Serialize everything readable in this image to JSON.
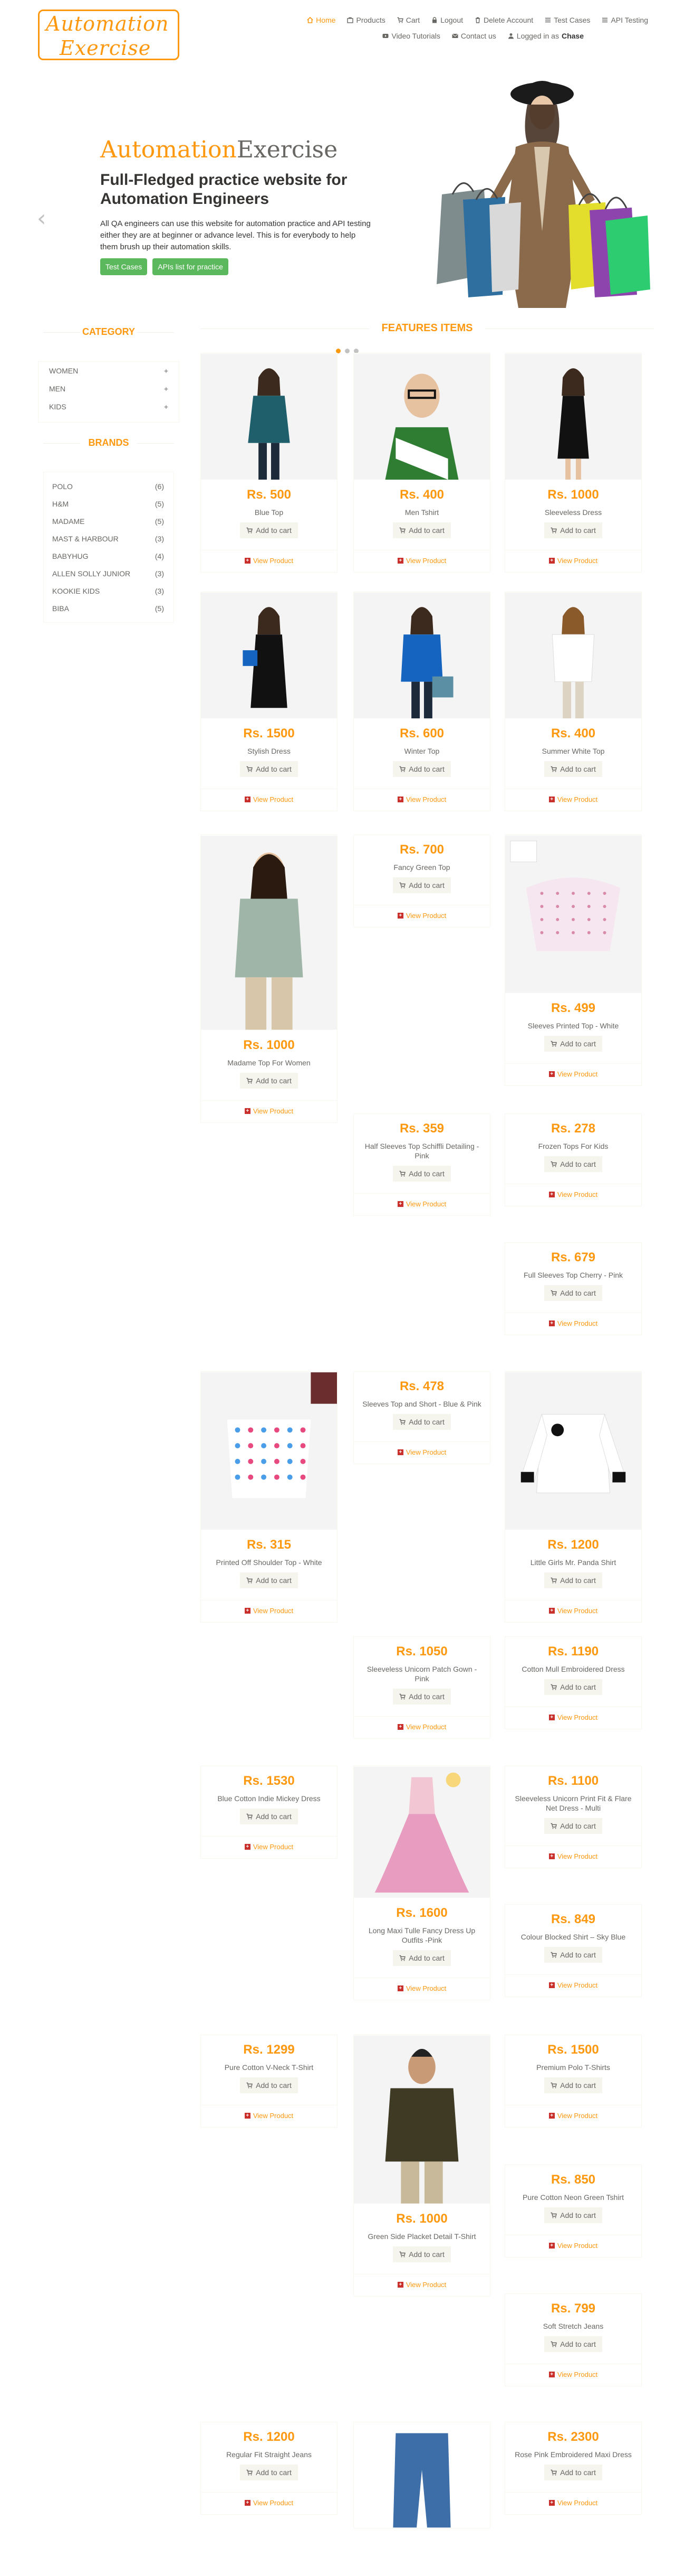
{
  "logo": {
    "line1": "Automation",
    "line2": "Exercise"
  },
  "nav": {
    "row1": [
      {
        "label": "Home",
        "icon": "home-icon",
        "active": true
      },
      {
        "label": "Products",
        "icon": "product-icon"
      },
      {
        "label": "Cart",
        "icon": "cart-icon"
      },
      {
        "label": "Logout",
        "icon": "lock-icon"
      },
      {
        "label": "Delete Account",
        "icon": "trash-icon"
      },
      {
        "label": "Test Cases",
        "icon": "list-icon"
      },
      {
        "label": "API Testing",
        "icon": "list-icon"
      }
    ],
    "row2": [
      {
        "label": "Video Tutorials",
        "icon": "youtube-icon"
      },
      {
        "label": "Contact us",
        "icon": "envelope-icon"
      },
      {
        "label": "Logged in as",
        "icon": "user-icon",
        "user": "Chase"
      }
    ]
  },
  "slider": {
    "brand_a": "Automation",
    "brand_b": "Exercise",
    "heading": "Full-Fledged practice website for Automation Engineers",
    "body": "All QA engineers can use this website for automation practice and API testing either they are at beginner or advance level. This is for everybody to help them brush up their automation skills.",
    "btn_test_cases": "Test Cases",
    "btn_apis": "APIs list for practice",
    "prev": "‹",
    "next": "›"
  },
  "sidebar": {
    "category_title": "CATEGORY",
    "categories": [
      "Women",
      "Men",
      "Kids"
    ],
    "brands_title": "BRANDS",
    "brands": [
      {
        "name": "Polo",
        "count": "(6)"
      },
      {
        "name": "H&M",
        "count": "(5)"
      },
      {
        "name": "Madame",
        "count": "(5)"
      },
      {
        "name": "Mast & Harbour",
        "count": "(3)"
      },
      {
        "name": "Babyhug",
        "count": "(4)"
      },
      {
        "name": "Allen Solly Junior",
        "count": "(3)"
      },
      {
        "name": "Kookie Kids",
        "count": "(3)"
      },
      {
        "name": "Biba",
        "count": "(5)"
      }
    ]
  },
  "features_title": "Features Items",
  "labels": {
    "add_to_cart": "Add to cart",
    "view_product": "View Product"
  },
  "products": [
    {
      "price": "Rs. 500",
      "name": "Blue Top",
      "img": "woman-blue-top"
    },
    {
      "price": "Rs. 400",
      "name": "Men Tshirt",
      "img": "man-tshirt"
    },
    {
      "price": "Rs. 1000",
      "name": "Sleeveless Dress",
      "img": "black-dress"
    },
    {
      "price": "Rs. 1500",
      "name": "Stylish Dress",
      "img": "stylish-dress"
    },
    {
      "price": "Rs. 600",
      "name": "Winter Top",
      "img": "winter-top"
    },
    {
      "price": "Rs. 400",
      "name": "Summer White Top",
      "img": "white-top"
    },
    {
      "price": "Rs. 1000",
      "name": "Madame Top For Women",
      "img": "madame-top"
    },
    {
      "price": "Rs. 700",
      "name": "Fancy Green Top",
      "img": ""
    },
    {
      "price": "Rs. 499",
      "name": "Sleeves Printed Top - White",
      "img": "kids-white-top"
    },
    {
      "price": "Rs. 359",
      "name": "Half Sleeves Top Schiffli Detailing - Pink",
      "img": ""
    },
    {
      "price": "Rs. 278",
      "name": "Frozen Tops For Kids",
      "img": ""
    },
    {
      "price": "Rs. 679",
      "name": "Full Sleeves Top Cherry - Pink",
      "img": ""
    },
    {
      "price": "Rs. 315",
      "name": "Printed Off Shoulder Top - White",
      "img": "kids-printed-top"
    },
    {
      "price": "Rs. 478",
      "name": "Sleeves Top and Short - Blue & Pink",
      "img": ""
    },
    {
      "price": "Rs. 1200",
      "name": "Little Girls Mr. Panda Shirt",
      "img": "panda-shirt"
    },
    {
      "price": "Rs. 1050",
      "name": "Sleeveless Unicorn Patch Gown - Pink",
      "img": ""
    },
    {
      "price": "Rs. 1190",
      "name": "Cotton Mull Embroidered Dress",
      "img": ""
    },
    {
      "price": "Rs. 1530",
      "name": "Blue Cotton Indie Mickey Dress",
      "img": ""
    },
    {
      "price": "Rs. 1600",
      "name": "Long Maxi Tulle Fancy Dress Up Outfits -Pink",
      "img": "pink-tulle"
    },
    {
      "price": "Rs. 1100",
      "name": "Sleeveless Unicorn Print Fit & Flare Net Dress - Multi",
      "img": ""
    },
    {
      "price": "Rs. 849",
      "name": "Colour Blocked Shirt – Sky Blue",
      "img": ""
    },
    {
      "price": "Rs. 1299",
      "name": "Pure Cotton V-Neck T-Shirt",
      "img": ""
    },
    {
      "price": "Rs. 1000",
      "name": "Green Side Placket Detail T-Shirt",
      "img": "green-tshirt"
    },
    {
      "price": "Rs. 1500",
      "name": "Premium Polo T-Shirts",
      "img": ""
    },
    {
      "price": "Rs. 850",
      "name": "Pure Cotton Neon Green Tshirt",
      "img": ""
    },
    {
      "price": "Rs. 799",
      "name": "Soft Stretch Jeans",
      "img": ""
    },
    {
      "price": "Rs. 1200",
      "name": "Regular Fit Straight Jeans",
      "img": ""
    },
    {
      "price": "",
      "name": "",
      "img": "jeans"
    },
    {
      "price": "Rs. 2300",
      "name": "Rose Pink Embroidered Maxi Dress",
      "img": ""
    }
  ]
}
